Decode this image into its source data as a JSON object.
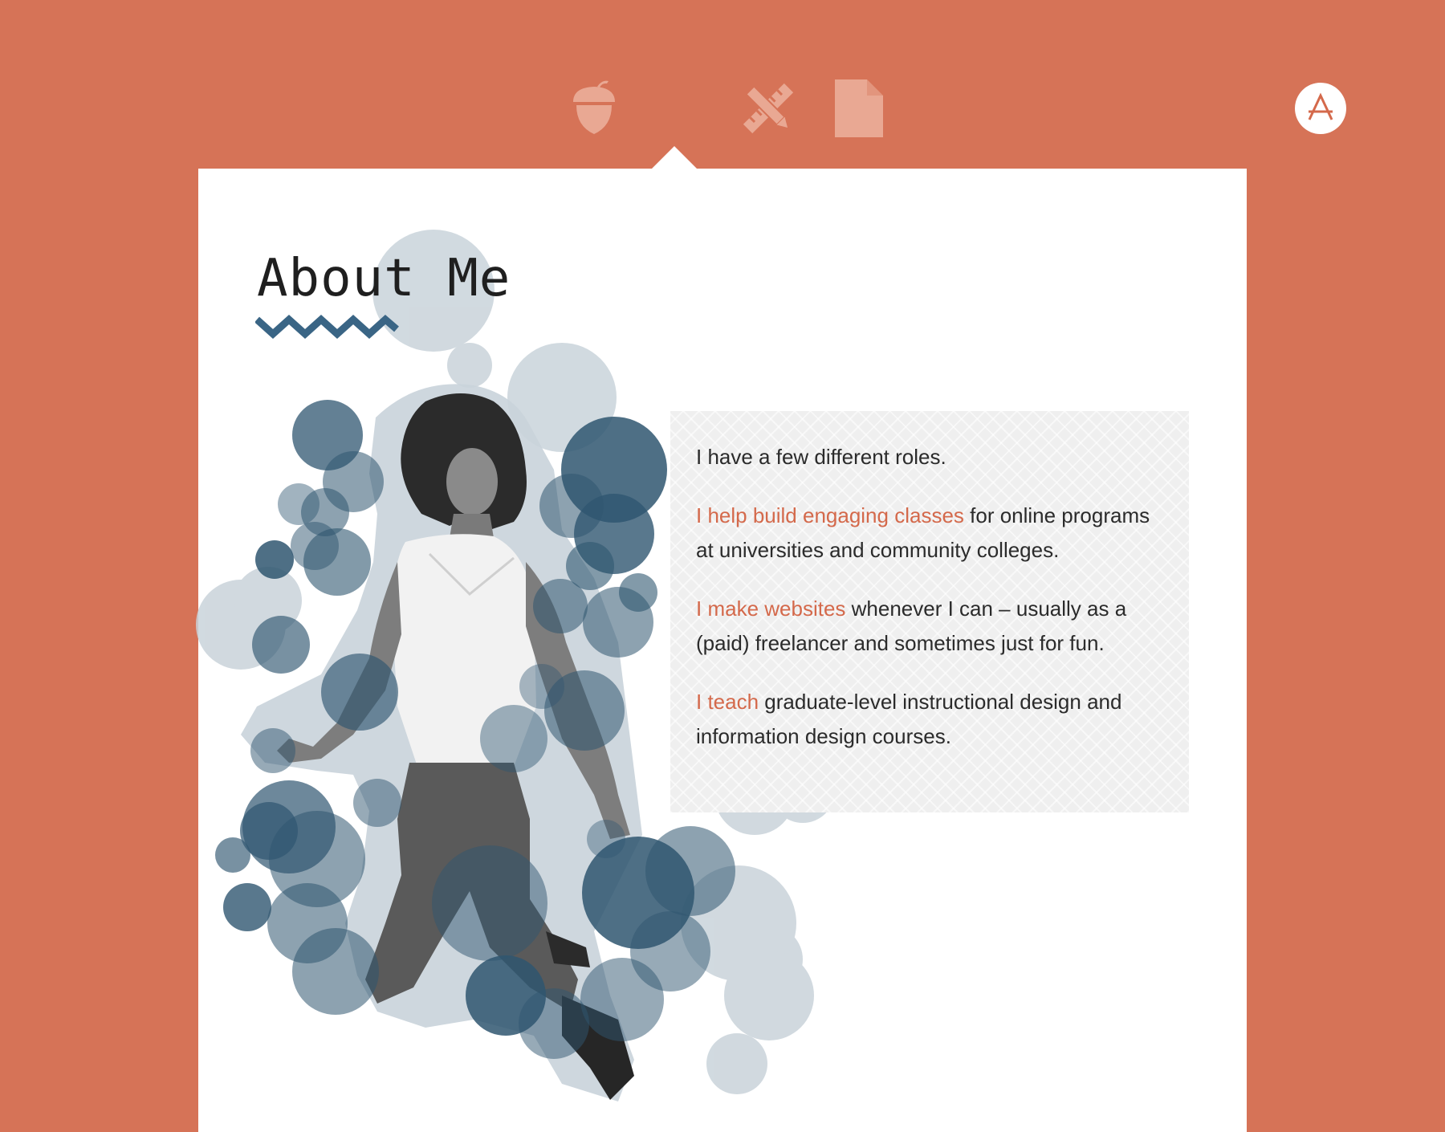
{
  "nav": {
    "items": [
      {
        "icon": "acorn-icon",
        "active": false
      },
      {
        "icon": "letter-a-icon",
        "active": true
      },
      {
        "icon": "pencil-ruler-icon",
        "active": false
      },
      {
        "icon": "document-icon",
        "active": false
      }
    ],
    "active_letter": "A"
  },
  "colors": {
    "background": "#d67357",
    "card": "#ffffff",
    "accent_link": "#d4694b",
    "bubble_dark": "#2f5670",
    "bubble_light": "#c9d3da",
    "zigzag": "#3a6585"
  },
  "page": {
    "title": "About Me"
  },
  "roles": {
    "intro": "I have a few different roles.",
    "role1_link": "I help build engaging classes",
    "role1_text": " for online programs at universities and community colleges.",
    "role2_link": "I make websites",
    "role2_text": " whenever I can – usually as a (paid) freelancer and sometimes just for fun.",
    "role3_link": "I teach",
    "role3_text": " graduate-level instructional design and information design courses."
  }
}
